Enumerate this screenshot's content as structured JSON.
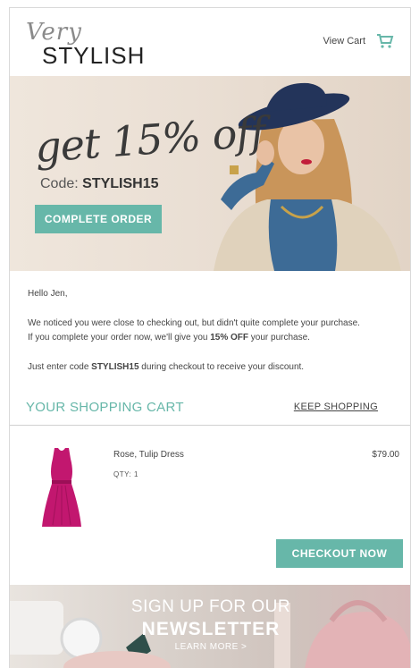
{
  "header": {
    "logo_script": "Very",
    "logo_word": "STYLISH",
    "view_cart_label": "View Cart",
    "cart_icon": "shopping-cart-icon"
  },
  "hero": {
    "offer_text": "get 15% off",
    "code_prefix": "Code: ",
    "code_value": "STYLISH15",
    "button_label": "COMPLETE ORDER"
  },
  "message": {
    "greeting": "Hello Jen,",
    "line1": "We noticed you were close to checking out, but didn't quite complete your purchase.",
    "line2_a": "If you complete your order now, we'll give you ",
    "line2_bold": "15% OFF",
    "line2_b": " your purchase.",
    "line3_a": "Just enter code ",
    "line3_bold": "STYLISH15",
    "line3_b": " during checkout to receive your discount."
  },
  "cart": {
    "title": "YOUR SHOPPING CART",
    "keep_shopping": "KEEP SHOPPING",
    "items": [
      {
        "name": "Rose, Tulip Dress",
        "qty": "QTY: 1",
        "price": "$79.00"
      }
    ],
    "checkout_label": "CHECKOUT NOW"
  },
  "newsletter": {
    "line1": "SIGN UP FOR OUR",
    "line2": "NEWSLETTER",
    "link": "LEARN MORE >"
  },
  "colors": {
    "accent": "#67b7a9",
    "dress": "#c2176f"
  }
}
